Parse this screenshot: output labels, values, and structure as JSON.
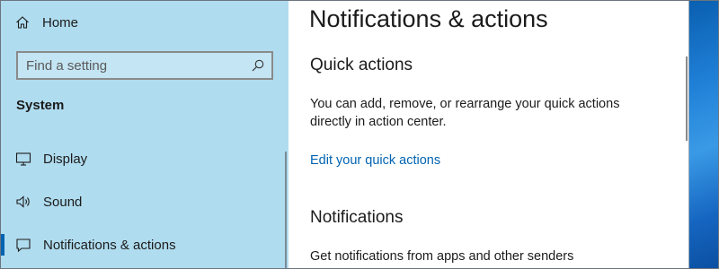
{
  "sidebar": {
    "home_label": "Home",
    "search": {
      "placeholder": "Find a setting"
    },
    "section_title": "System",
    "items": [
      {
        "label": "Display",
        "icon": "monitor-icon"
      },
      {
        "label": "Sound",
        "icon": "speaker-icon"
      },
      {
        "label": "Notifications & actions",
        "icon": "message-icon",
        "active": true
      }
    ]
  },
  "main": {
    "title": "Notifications & actions",
    "quick_actions": {
      "heading": "Quick actions",
      "description": "You can add, remove, or rearrange your quick actions directly in action center.",
      "link": "Edit your quick actions"
    },
    "notifications": {
      "heading": "Notifications",
      "description": "Get notifications from apps and other senders"
    }
  },
  "colors": {
    "sidebar_bg": "#b0dcef",
    "accent": "#0063b1",
    "text": "#1b1b1b"
  }
}
